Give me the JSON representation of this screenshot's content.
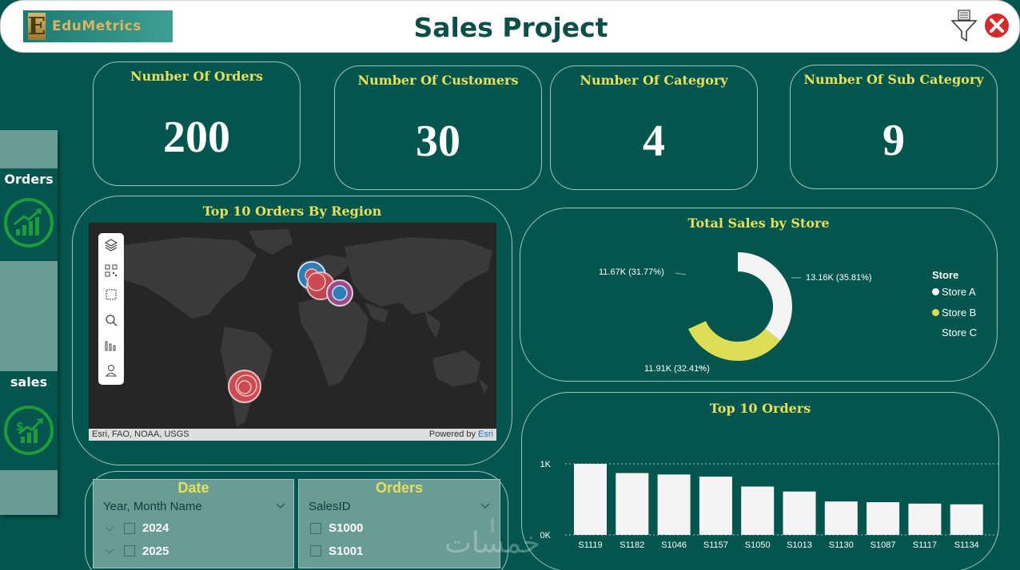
{
  "header": {
    "logo_letter": "E",
    "logo_text": "EduMetrics",
    "title": "Sales Project",
    "filter_icon": "funnel-icon",
    "close_icon": "close-circle-icon"
  },
  "sidebar": {
    "items": [
      {
        "label": "Orders",
        "icon": "growth-chart-icon"
      },
      {
        "label": "sales",
        "icon": "dollar-growth-chart-icon"
      }
    ]
  },
  "kpis": [
    {
      "title": "Number Of Orders",
      "value": "200"
    },
    {
      "title": "Number Of Customers",
      "value": "30"
    },
    {
      "title": "Number Of Category",
      "value": "4"
    },
    {
      "title": "Number Of Sub Category",
      "value": "9"
    }
  ],
  "map": {
    "title": "Top 10 Orders By Region",
    "attribution_left": "Esri, FAO, NOAA, USGS",
    "attribution_powered": "Powered by ",
    "attribution_brand": "Esri",
    "tools": [
      "layers-icon",
      "qr-code-icon",
      "select-rect-icon",
      "search-icon",
      "bars-icon",
      "person-icon"
    ]
  },
  "donut": {
    "title": "Total Sales by Store",
    "legend_title": "Store",
    "colors": {
      "Store A": "#f4f4f4",
      "Store B": "#dede55",
      "Store C": "#03564e"
    }
  },
  "slicers": {
    "date": {
      "title": "Date",
      "dropdown": "Year, Month Name",
      "items": [
        "2024",
        "2025"
      ]
    },
    "orders": {
      "title": "Orders",
      "dropdown": "SalesID",
      "items": [
        "S1000",
        "S1001"
      ]
    }
  },
  "bar": {
    "title": "Top 10 Orders"
  },
  "watermark": "خمسات",
  "chart_data": [
    {
      "type": "pie",
      "title": "Total Sales by Store",
      "legend": "right",
      "categories": [
        "Store A",
        "Store B",
        "Store C"
      ],
      "values": [
        13.16,
        11.91,
        11.67
      ],
      "labels": [
        "13.16K (35.81%)",
        "11.91K (32.41%)",
        "11.67K (31.77%)"
      ],
      "unit": "K"
    },
    {
      "type": "bar",
      "title": "Top 10 Orders",
      "categories": [
        "S1119",
        "S1182",
        "S1046",
        "S1157",
        "S1050",
        "S1013",
        "S1130",
        "S1087",
        "S1117",
        "S1134"
      ],
      "values": [
        1000,
        870,
        850,
        820,
        680,
        610,
        470,
        460,
        440,
        430
      ],
      "yticks": [
        "1K",
        "0K"
      ],
      "ylim": [
        0,
        1000
      ],
      "grid": true
    }
  ]
}
